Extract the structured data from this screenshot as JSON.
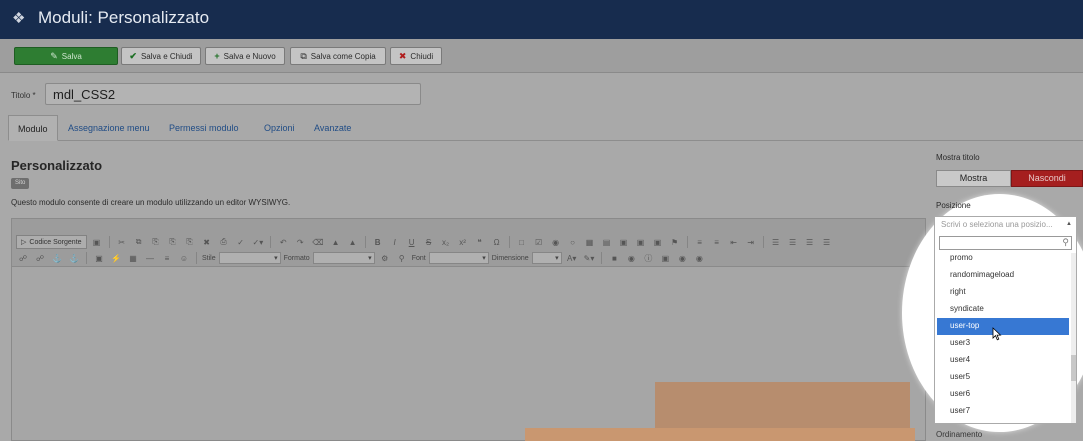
{
  "header": {
    "title": "Moduli: Personalizzato",
    "logo_icon": "cube-icon"
  },
  "toolbar": {
    "save": "Salva",
    "save_close": "Salva e Chiudi",
    "save_new": "Salva e Nuovo",
    "save_copy": "Salva come Copia",
    "close": "Chiudi"
  },
  "form": {
    "title_label": "Titolo *",
    "title_value": "mdl_CSS2"
  },
  "tabs": [
    "Modulo",
    "Assegnazione menu",
    "Permessi modulo",
    "Opzioni",
    "Avanzate"
  ],
  "module": {
    "heading": "Personalizzato",
    "badge": "Sito",
    "description": "Questo modulo consente di creare un modulo utilizzando un editor WYSIWYG."
  },
  "editor": {
    "source_button": "Codice Sorgente",
    "style_label": "Stile",
    "format_label": "Formato",
    "font_label": "Font",
    "size_label": "Dimensione"
  },
  "sidebar": {
    "show_title_label": "Mostra titolo",
    "show": "Mostra",
    "hide": "Nascondi",
    "position_label": "Posizione",
    "position_placeholder": "Scrivi o seleziona una posizio...",
    "position_items": [
      "promo",
      "randomimageload",
      "right",
      "syndicate",
      "user-top",
      "user3",
      "user4",
      "user5",
      "user6",
      "user7"
    ],
    "selected_item": "user-top",
    "ordering_label": "Ordinamento"
  },
  "colors": {
    "header_bg": "#172c4e",
    "save_green": "#2e7d32",
    "hide_red": "#a51f1f",
    "highlight_blue": "#3778d3",
    "annotation_arrow": "#c99770"
  }
}
